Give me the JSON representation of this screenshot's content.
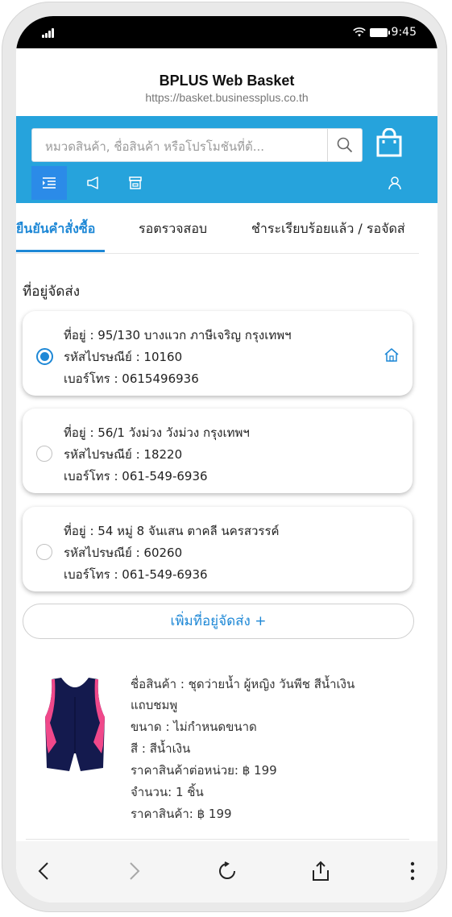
{
  "status_bar": {
    "time": "9:45"
  },
  "browser": {
    "title": "BPLUS Web Basket",
    "url": "https://basket.businessplus.co.th"
  },
  "search": {
    "placeholder": "หมวดสินค้า, ชื่อสินค้า หรือโปรโมชันที่ต้..."
  },
  "tabs": [
    {
      "label": "ยืนยันคำสั่งซื้อ",
      "active": true
    },
    {
      "label": "รอตรวจสอบ",
      "active": false
    },
    {
      "label": "ชำระเรียบร้อยแล้ว / รอจัดส่",
      "active": false
    }
  ],
  "shipping": {
    "section_label": "ที่อยู่จัดส่ง",
    "addresses": [
      {
        "address": "ที่อยู่ : 95/130 บางแวก ภาษีเจริญ กรุงเทพฯ",
        "postal": "รหัสไปรษณีย์ : 10160",
        "phone": "เบอร์โทร : 0615496936",
        "selected": true,
        "icon": "home-icon"
      },
      {
        "address": "ที่อยู่ : 56/1 วังม่วง วังม่วง กรุงเทพฯ",
        "postal": "รหัสไปรษณีย์ : 18220",
        "phone": "เบอร์โทร : 061-549-6936",
        "selected": false
      },
      {
        "address": "ที่อยู่ : 54 หมู่ 8 จันเสน ตาคลี นครสวรรค์",
        "postal": "รหัสไปรษณีย์ : 60260",
        "phone": "เบอร์โทร : 061-549-6936",
        "selected": false
      }
    ],
    "add_label": "เพิ่มที่อยู่จัดส่ง +"
  },
  "product": {
    "name_line1": "ชื่อสินค้า : ชุดว่ายน้ำ ผู้หญิง วันพีช สีน้ำเงิน",
    "name_line2": "แถบชมพู",
    "size": "ขนาด : ไม่กำหนดขนาด",
    "color": "สี : สีน้ำเงิน",
    "unit_price": "ราคาสินค้าต่อหน่วย: ฿ 199",
    "quantity": "จำนวน: 1 ชิ้น",
    "price": "ราคาสินค้า: ฿ 199"
  },
  "colors": {
    "accent": "#26a3dc",
    "active_blue": "#1e88d6",
    "icon_active_bg": "#2b8be8",
    "swimsuit_navy": "#141a4e",
    "swimsuit_pink": "#f0488a"
  }
}
